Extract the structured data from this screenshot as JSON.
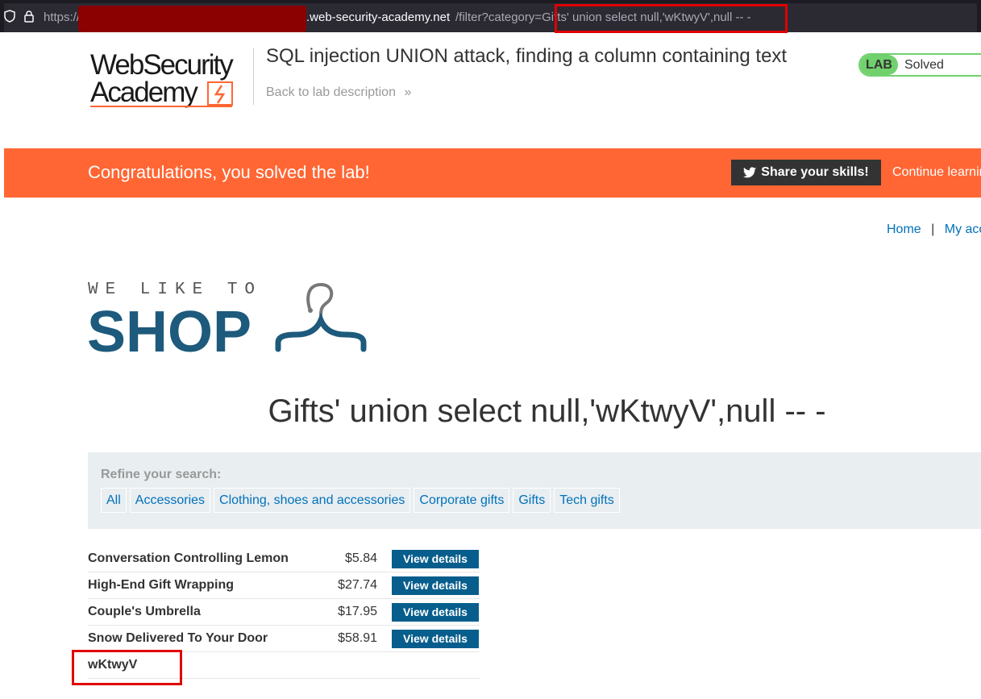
{
  "browser": {
    "url_protocol": "https://",
    "url_host": ".web-security-academy.net",
    "url_path": "/filter?category=Gifts' union select null,'wKtwyV',null -- -"
  },
  "header": {
    "logo_line1": "WebSecurity",
    "logo_line2": "Academy",
    "lab_title": "SQL injection UNION attack, finding a column containing text",
    "back_link": "Back to lab description",
    "lab_badge": "LAB",
    "lab_status": "Solved"
  },
  "banner": {
    "message": "Congratulations, you solved the lab!",
    "share_label": "Share your skills!",
    "continue_label": "Continue learning"
  },
  "nav": {
    "home": "Home",
    "separator": "|",
    "account": "My account"
  },
  "shop_logo": {
    "tagline": "WE LIKE TO",
    "word": "SHOP"
  },
  "page": {
    "heading": "Gifts' union select null,'wKtwyV',null -- -"
  },
  "refine": {
    "label": "Refine your search:",
    "categories": [
      "All",
      "Accessories",
      "Clothing, shoes and accessories",
      "Corporate gifts",
      "Gifts",
      "Tech gifts"
    ]
  },
  "products": [
    {
      "name": "Conversation Controlling Lemon",
      "price": "$5.84",
      "button": "View details"
    },
    {
      "name": "High-End Gift Wrapping",
      "price": "$27.74",
      "button": "View details"
    },
    {
      "name": "Couple's Umbrella",
      "price": "$17.95",
      "button": "View details"
    },
    {
      "name": "Snow Delivered To Your Door",
      "price": "$58.91",
      "button": "View details"
    },
    {
      "name": "wKtwyV",
      "price": "",
      "button": ""
    }
  ],
  "colors": {
    "accent_orange": "#ff6633",
    "lab_green": "#70d16d",
    "link_blue": "#0071bc",
    "button_blue": "#075e8c",
    "highlight_red": "#e00000"
  }
}
